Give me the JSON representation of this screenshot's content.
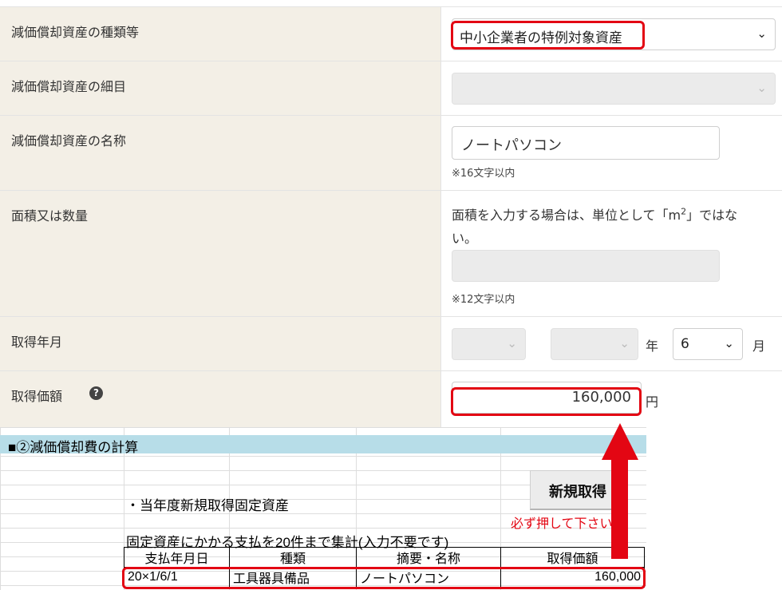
{
  "form": {
    "rows": [
      {
        "label": "減価償却資産の種類等",
        "value": "中小企業者の特例対象資産"
      },
      {
        "label": "減価償却資産の細目",
        "value": ""
      },
      {
        "label": "減価償却資産の名称",
        "value": "ノートパソコン",
        "note": "※16文字以内"
      },
      {
        "label": "面積又は数量",
        "instruction_part1": "面積を入力する場合は、単位として「m",
        "instruction_sup": "2",
        "instruction_part2": "」ではな",
        "instruction_line2": "い。",
        "value": "",
        "note": "※12文字以内"
      },
      {
        "label": "取得年月",
        "era": "",
        "year": "",
        "year_unit": "年",
        "month": "6",
        "month_unit": "月"
      },
      {
        "label": "取得価額",
        "help_icon": "?",
        "value": "160,000",
        "unit": "円"
      }
    ]
  },
  "sheet": {
    "section_title": "■②減価償却費の計算",
    "subtitle": "・当年度新規取得固定資産",
    "new_button": "新規取得",
    "must_press": "必ず押して下さい",
    "table_caption": "固定資産にかかる支払を20件まで集計(入力不要です)",
    "headers": [
      "支払年月日",
      "種類",
      "摘要・名称",
      "取得価額"
    ],
    "rows": [
      [
        "20×1/6/1",
        "工具器具備品",
        "ノートパソコン",
        "160,000"
      ]
    ]
  },
  "colors": {
    "highlight": "#e30613",
    "label_bg": "#f3efe6",
    "section_header_bg": "#b7dde8"
  }
}
